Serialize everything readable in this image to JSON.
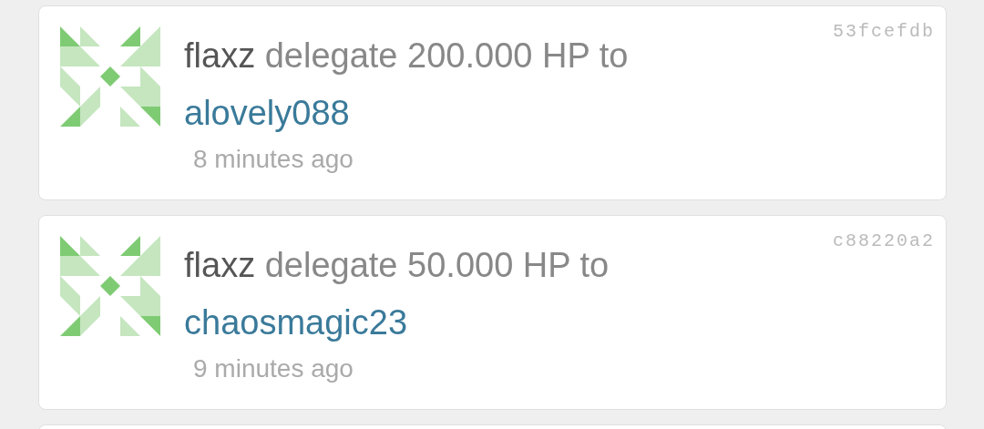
{
  "operations": [
    {
      "actor": "flaxz",
      "text": "delegate 200.000 HP to",
      "target": "alovely088",
      "time": "8 minutes ago",
      "hash": "53fcefdb"
    },
    {
      "actor": "flaxz",
      "text": "delegate 50.000 HP to",
      "target": "chaosmagic23",
      "time": "9 minutes ago",
      "hash": "c88220a2"
    }
  ]
}
